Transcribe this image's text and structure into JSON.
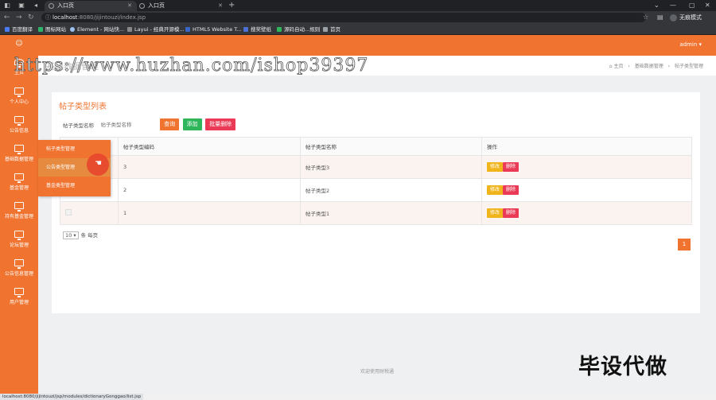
{
  "browser": {
    "tabs": [
      {
        "label": "入口页",
        "active": true
      },
      {
        "label": "入口页",
        "active": false
      }
    ],
    "url_host": "localhost",
    "url_path": ":8080/jijintouzi/index.jsp",
    "profile": "无痕模式",
    "bookmarks": [
      "百度翻译",
      "图标网站",
      "Element - 网站快...",
      "Layui - 经典开源模...",
      "HTML5 Website T...",
      "搜奖壁纸",
      "源码自动...规则",
      "首页"
    ],
    "status_url": "localhost:8080/jijintouzi/jsp/modules/dictionaryGonggao/list.jsp"
  },
  "header": {
    "user": "admin ▾"
  },
  "sidebar": {
    "logo": "☺",
    "items": [
      {
        "label": "主页"
      },
      {
        "label": "个人中心"
      },
      {
        "label": "公告信息"
      },
      {
        "label": "基础数据管理"
      },
      {
        "label": "基金管理"
      },
      {
        "label": "持有基金管理"
      },
      {
        "label": "论坛管理"
      },
      {
        "label": "公告信息管理"
      },
      {
        "label": "用户管理"
      }
    ],
    "flyout": [
      "帖子类型管理",
      "公告类型管理",
      "基金类型管理"
    ]
  },
  "main": {
    "title": "基础数据管理",
    "breadcrumb": [
      "⌂ 主页",
      "›",
      "基础数据管理",
      "›",
      "帖子类型管理"
    ],
    "card_title": "帖子类型列表",
    "search_label": "帖子类型名称",
    "search_placeholder": "帖子类型名称",
    "btn_query": "查询",
    "btn_add": "添加",
    "btn_batch_delete": "批量删除",
    "table": {
      "headers": [
        "",
        "帖子类型编码",
        "帖子类型名称",
        "操作"
      ],
      "rows": [
        {
          "code": "3",
          "name": "帖子类型3"
        },
        {
          "code": "2",
          "name": "帖子类型2"
        },
        {
          "code": "1",
          "name": "帖子类型1"
        }
      ],
      "edit_label": "修改",
      "delete_label": "删除"
    },
    "page_size": "10 ▾",
    "per_page_label": "条 每页",
    "current_page": "1",
    "footer": "欢迎使用财税通"
  },
  "overlay": {
    "watermark": "https://www.huzhan.com/ishop39397",
    "stamp": "毕设代做"
  },
  "colors": {
    "brand": "#f0732f",
    "green": "#2fb55a",
    "red": "#ea3a55",
    "yellow": "#f1b51c"
  }
}
